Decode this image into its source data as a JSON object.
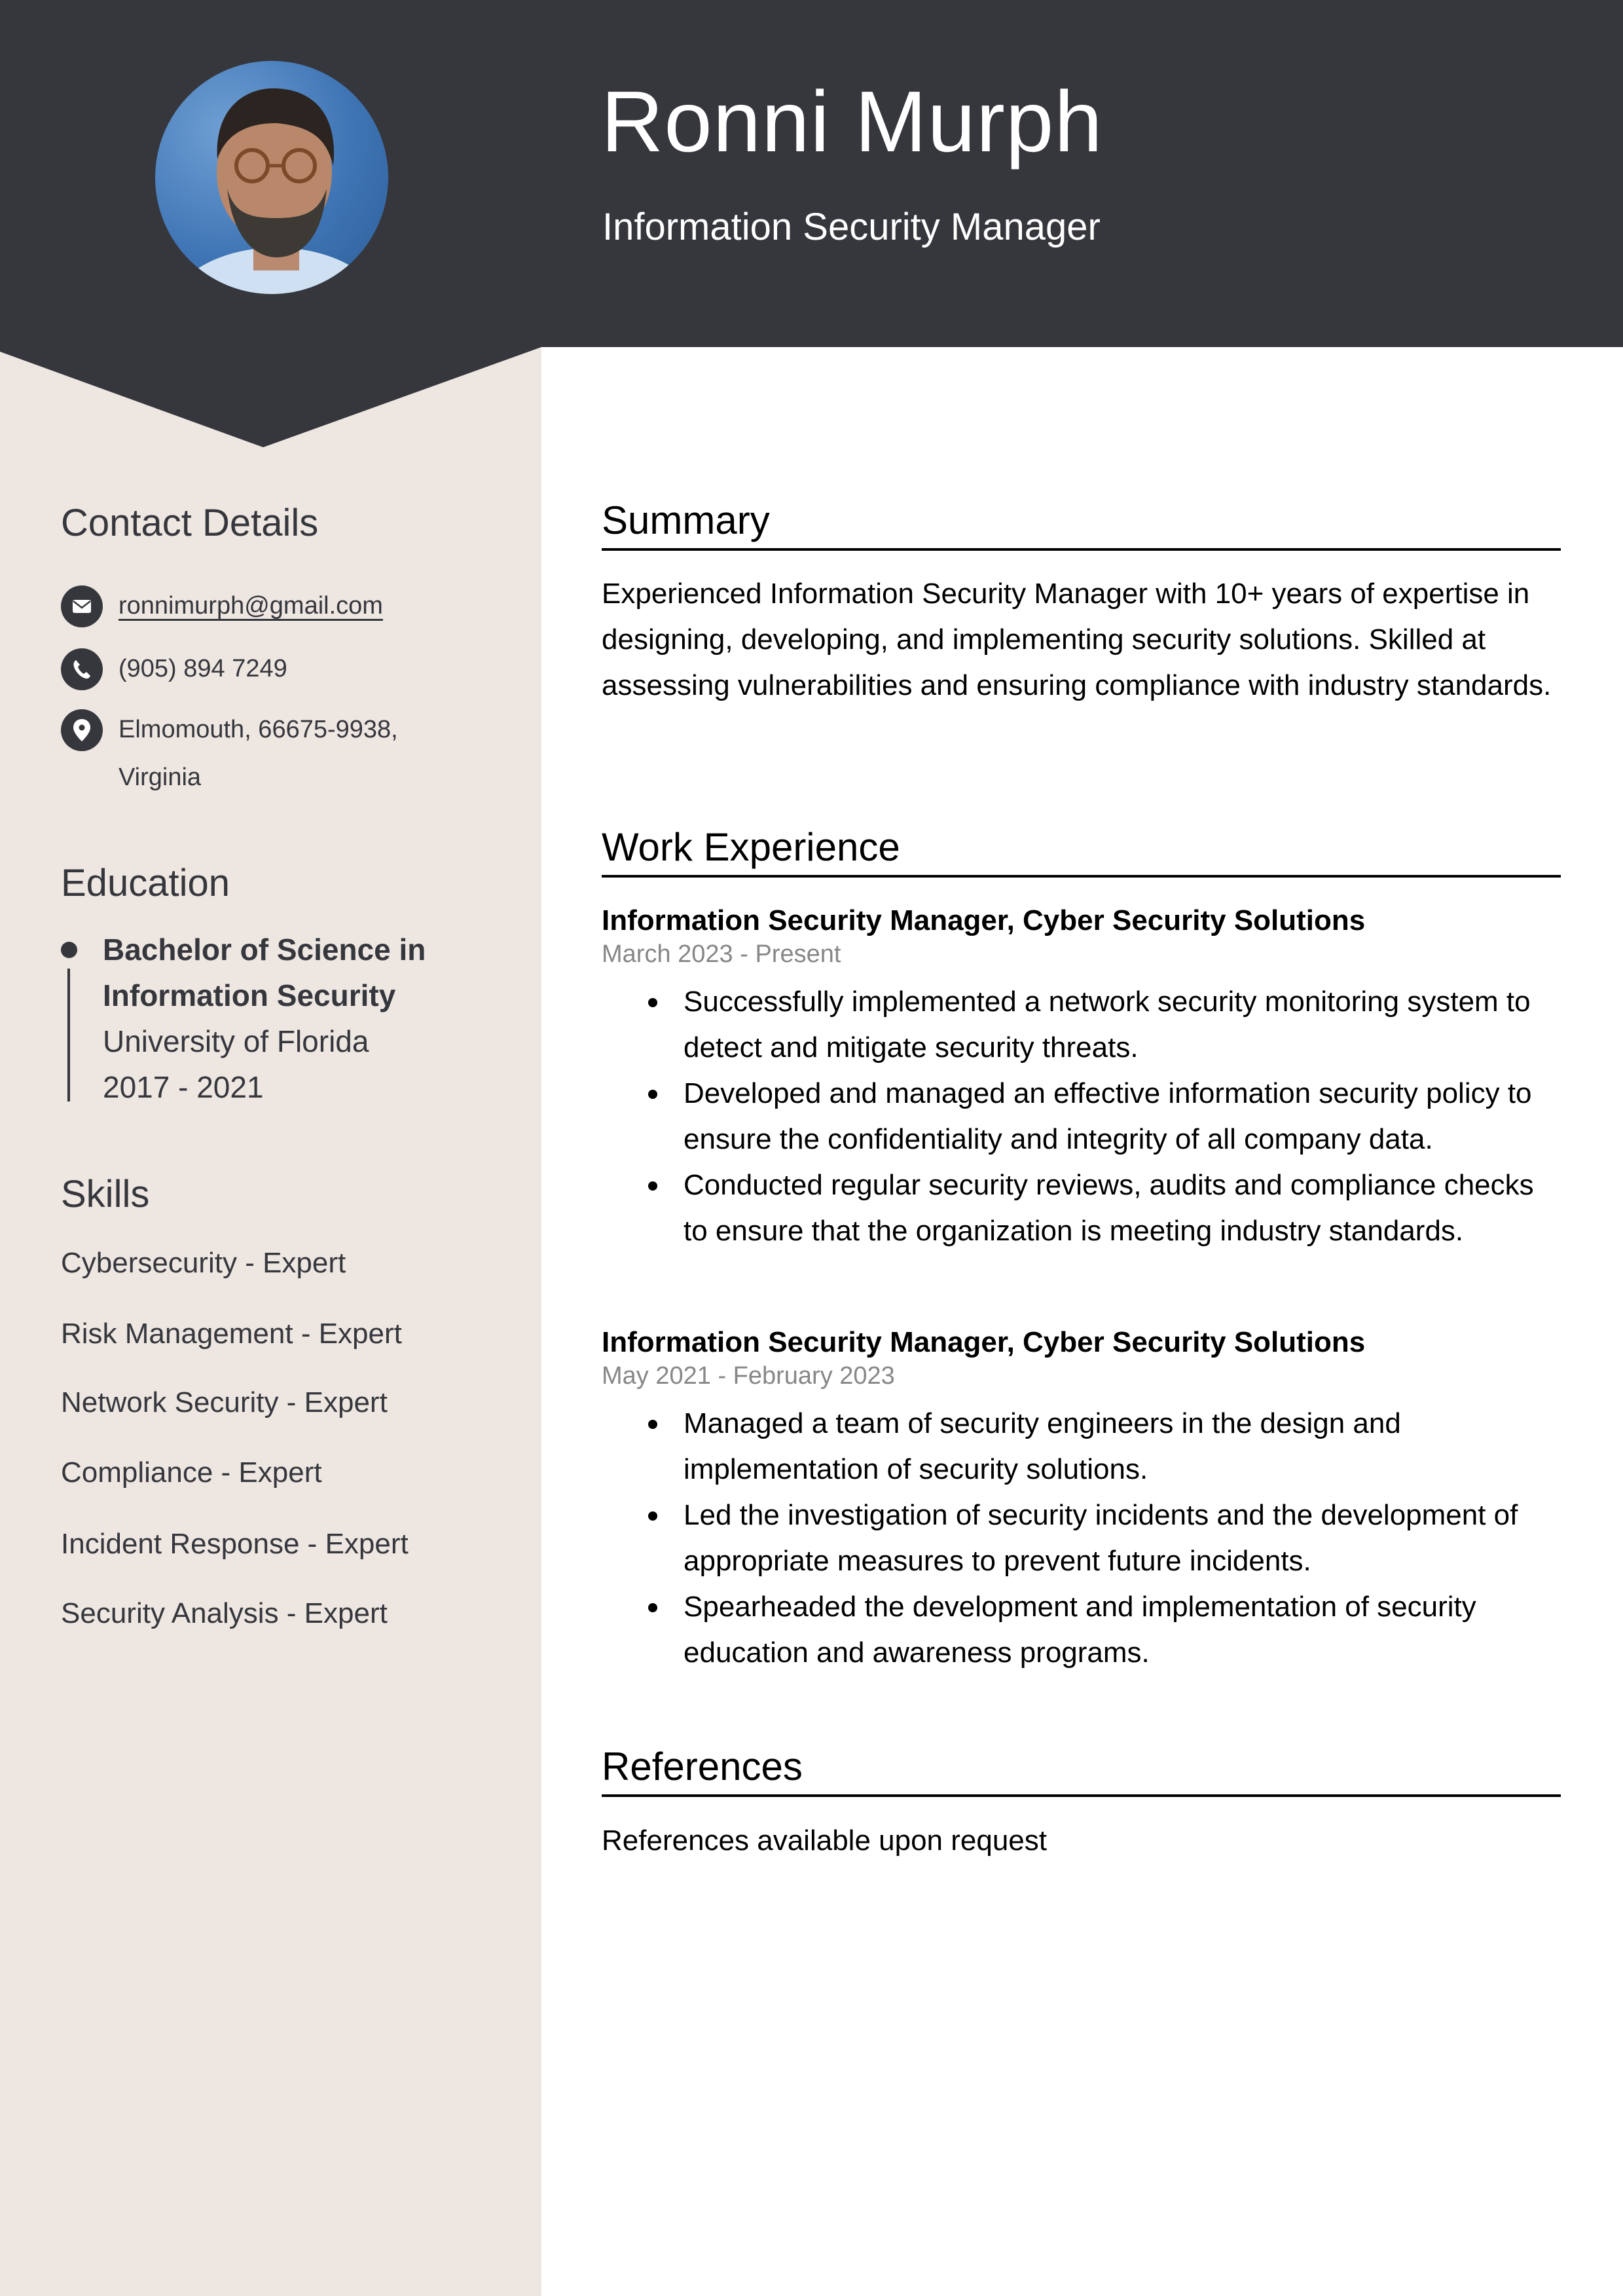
{
  "colors": {
    "header_dark": "#36373d",
    "sidebar_bg": "#ede6e1",
    "text_dark": "#36373d",
    "date_grey": "#878787"
  },
  "header": {
    "name": "Ronni Murph",
    "title": "Information Security Manager",
    "photo_alt": "Profile photo of Ronni Murph"
  },
  "sidebar": {
    "contact": {
      "heading": "Contact Details",
      "email": "ronnimurph@gmail.com",
      "phone": "(905) 894 7249",
      "address_line1": "Elmomouth, 66675-9938,",
      "address_line2": "Virginia"
    },
    "education": {
      "heading": "Education",
      "degree_line1": "Bachelor of Science in",
      "degree_line2": "Information Security",
      "school": "University of Florida",
      "years": "2017 - 2021"
    },
    "skills": {
      "heading": "Skills",
      "items": [
        "Cybersecurity - Expert",
        "Risk Management - Expert",
        "Network Security - Expert",
        "Compliance - Expert",
        "Incident Response - Expert",
        "Security Analysis - Expert"
      ]
    }
  },
  "main": {
    "summary": {
      "heading": "Summary",
      "text": "Experienced Information Security Manager with 10+ years of expertise in designing, developing, and implementing security solutions. Skilled at assessing vulnerabilities and ensuring compliance with industry standards."
    },
    "experience": {
      "heading": "Work Experience",
      "jobs": [
        {
          "title": "Information Security Manager, Cyber Security Solutions",
          "dates": "March 2023 - Present",
          "bullets": [
            "Successfully implemented a network security monitoring system to detect and mitigate security threats.",
            "Developed and managed an effective information security policy to ensure the confidentiality and integrity of all company data.",
            "Conducted regular security reviews, audits and compliance checks to ensure that the organization is meeting industry standards."
          ]
        },
        {
          "title": "Information Security Manager, Cyber Security Solutions",
          "dates": "May 2021 - February 2023",
          "bullets": [
            "Managed a team of security engineers in the design and implementation of security solutions.",
            "Led the investigation of security incidents and the development of appropriate measures to prevent future incidents.",
            "Spearheaded the development and implementation of security education and awareness programs."
          ]
        }
      ]
    },
    "references": {
      "heading": "References",
      "text": "References available upon request"
    }
  }
}
